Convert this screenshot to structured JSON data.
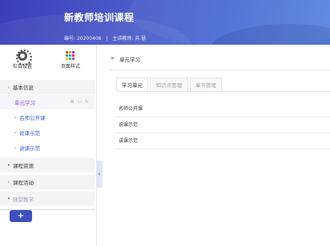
{
  "header": {
    "course_title": "新教师培训课程",
    "code_label": "编号:",
    "code_value": "20200408",
    "teacher_label": "主讲教师:",
    "teacher_value": "苏 慧"
  },
  "sidebar": {
    "tools": [
      {
        "label": "栏目设置",
        "icon": "gear-icon"
      },
      {
        "label": "页面样式",
        "icon": "color-grid-icon"
      }
    ],
    "items": [
      {
        "label": "基本信息",
        "kind": "section",
        "icon": "chevron-right"
      },
      {
        "label": "单元学习",
        "kind": "active",
        "icon": ""
      },
      {
        "label": "名师公开课",
        "kind": "sub",
        "icon": "chevron-right"
      },
      {
        "label": "说课示范",
        "kind": "sub",
        "icon": "chevron-right"
      },
      {
        "label": "讲课示范",
        "kind": "sub",
        "icon": "chevron-right"
      },
      {
        "label": "课程资源",
        "kind": "section",
        "icon": "bullet"
      },
      {
        "label": "课程活动",
        "kind": "section",
        "icon": "chevron-right"
      },
      {
        "label": "随堂教学",
        "kind": "section-muted",
        "icon": "bullet"
      }
    ],
    "row_actions": "⊞ ▭ ✎",
    "add_label": "+",
    "collapse_glyph": "‹"
  },
  "main": {
    "title_glyph": "»",
    "title": "单元学习",
    "tabs": [
      {
        "label": "学习单元",
        "active": true
      },
      {
        "label": "知识点管理",
        "active": false
      },
      {
        "label": "章节管理",
        "active": false
      }
    ],
    "rows": [
      "名师公开课",
      "说课示范",
      "讲课示范"
    ]
  },
  "colors": {
    "header_gradient_start": "#3b3db8",
    "header_gradient_end": "#5a86de",
    "accent": "#8a5ad6",
    "link": "#3b5bd0",
    "add_button": "#3e4fbf"
  }
}
